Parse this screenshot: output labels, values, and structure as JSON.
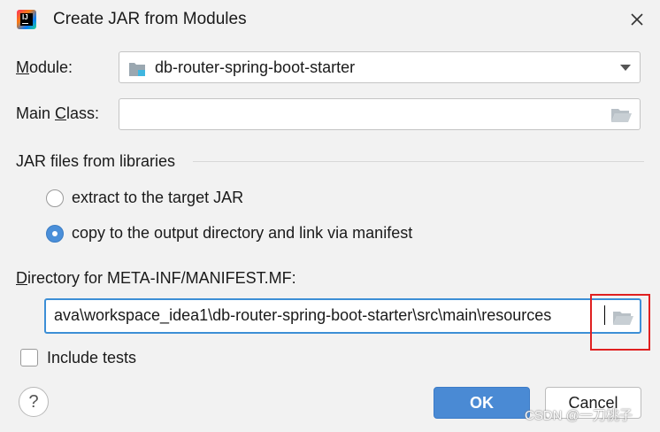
{
  "dialog": {
    "title": "Create JAR from Modules"
  },
  "module": {
    "label_prefix": "",
    "label_mnemonic": "M",
    "label_rest": "odule:",
    "value": "db-router-spring-boot-starter"
  },
  "main_class": {
    "label_prefix": "Main ",
    "label_mnemonic": "C",
    "label_rest": "lass:",
    "value": ""
  },
  "libraries": {
    "section_label": "JAR files from libraries",
    "options": [
      {
        "label": "extract to the target JAR",
        "selected": false
      },
      {
        "label": "copy to the output directory and link via manifest",
        "selected": true
      }
    ]
  },
  "manifest_dir": {
    "label_mnemonic": "D",
    "label_rest": "irectory for META-INF/MANIFEST.MF:",
    "value": "ava\\workspace_idea1\\db-router-spring-boot-starter\\src\\main\\resources"
  },
  "include_tests": {
    "label": "Include tests",
    "checked": false
  },
  "buttons": {
    "help": "?",
    "ok": "OK",
    "cancel": "Cancel"
  },
  "watermark": "CSDN @一刀桃子",
  "colors": {
    "accent": "#4a8ad4",
    "focus_border": "#3d8fd6",
    "highlight_annotation": "#e02020"
  },
  "icons": {
    "app": "intellij-idea-icon",
    "close": "close-icon",
    "module": "module-folder-icon",
    "dropdown": "chevron-down-icon",
    "browse": "folder-open-icon"
  }
}
